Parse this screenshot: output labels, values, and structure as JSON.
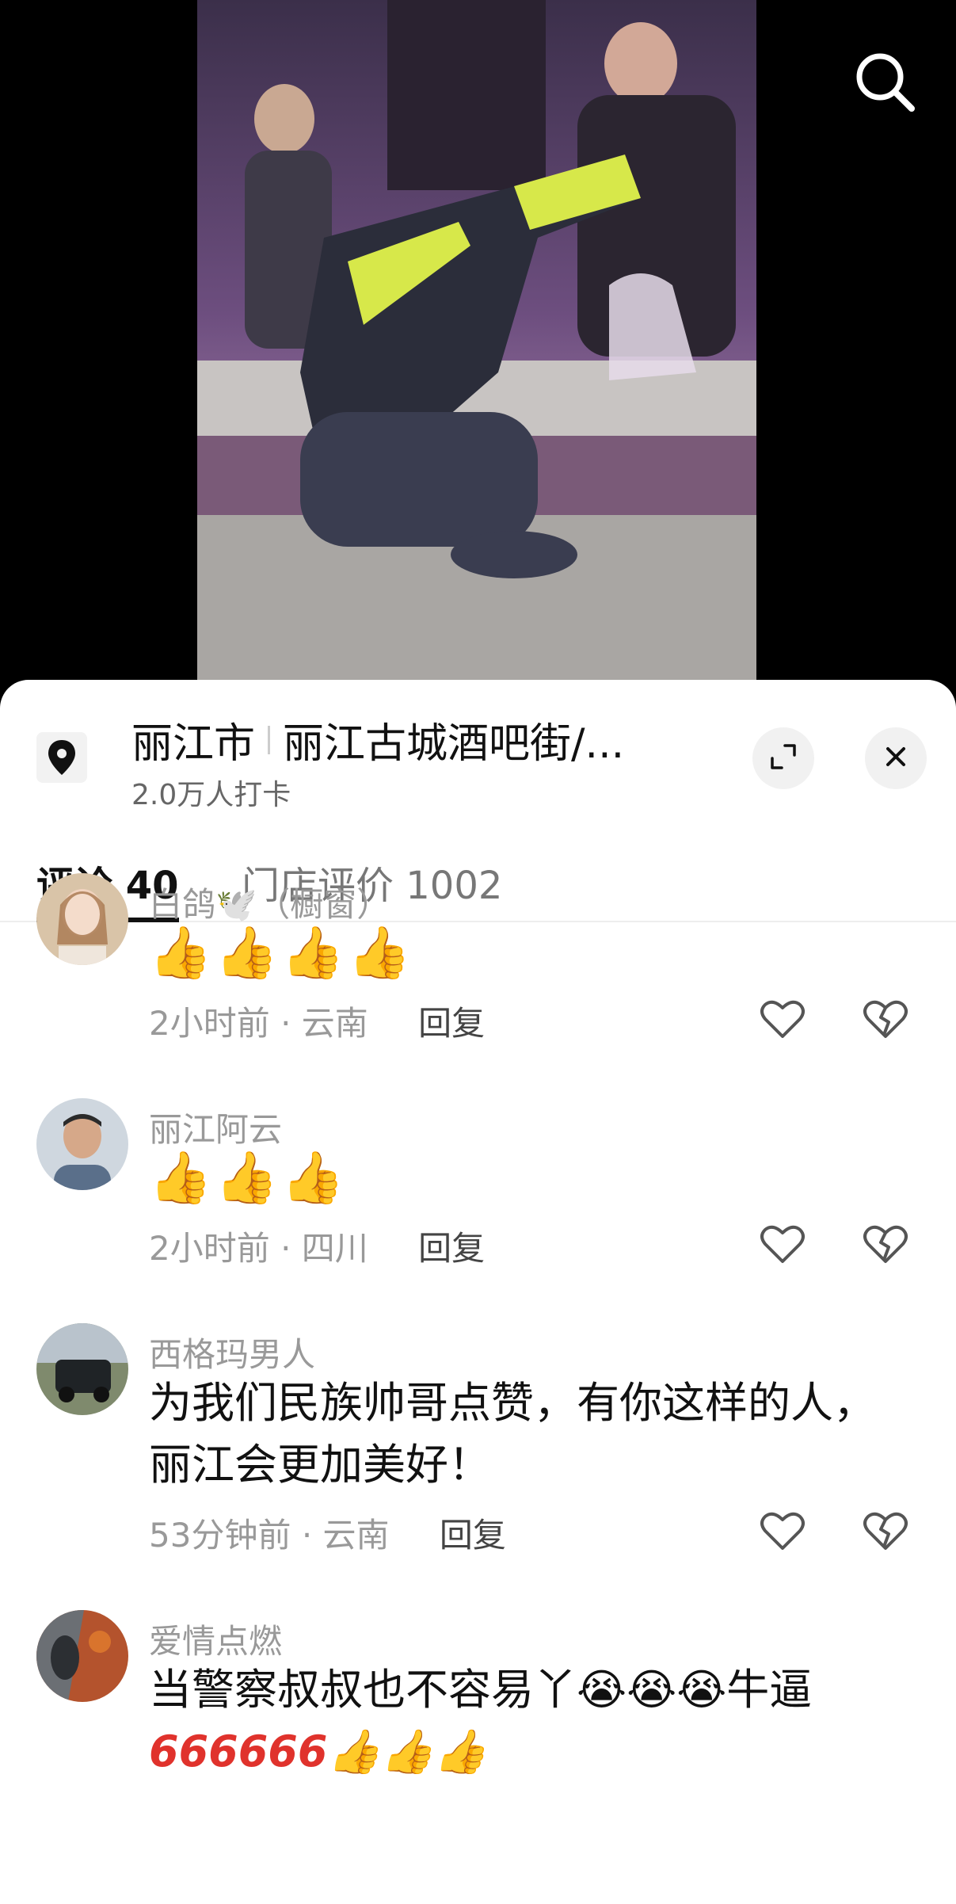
{
  "video": {
    "search_icon": "search-icon"
  },
  "poi": {
    "city": "丽江市",
    "place": "丽江古城酒吧街/...",
    "checkins": "2.0万人打卡",
    "pin_icon": "location-pin-icon",
    "expand_icon": "expand-icon",
    "close_icon": "close-icon"
  },
  "tabs": [
    {
      "label": "评论 40",
      "active": true
    },
    {
      "label": "门店评价 1002",
      "active": false
    }
  ],
  "comments": [
    {
      "name": "白鸽🕊️（橱窗）",
      "text": "",
      "emojis": [
        "👍",
        "👍",
        "👍",
        "👍"
      ],
      "time": "2小时前",
      "location": "云南",
      "reply": "回复"
    },
    {
      "name": "丽江阿云",
      "text": "",
      "emojis": [
        "👍",
        "👍",
        "👍"
      ],
      "time": "2小时前",
      "location": "四川",
      "reply": "回复"
    },
    {
      "name": "西格玛男人",
      "text": "为我们民族帅哥点赞，有你这样的人，丽江会更加美好！",
      "emojis": [],
      "time": "53分钟前",
      "location": "云南",
      "reply": "回复"
    },
    {
      "name": "爱情点燃",
      "text": "当警察叔叔也不容易丫😭😭😭牛逼",
      "text2": "666666👍👍👍",
      "emojis": [],
      "time": "",
      "location": "",
      "reply": ""
    }
  ],
  "colors": {
    "accent_dark": "#111111",
    "meta_gray": "#999999"
  }
}
